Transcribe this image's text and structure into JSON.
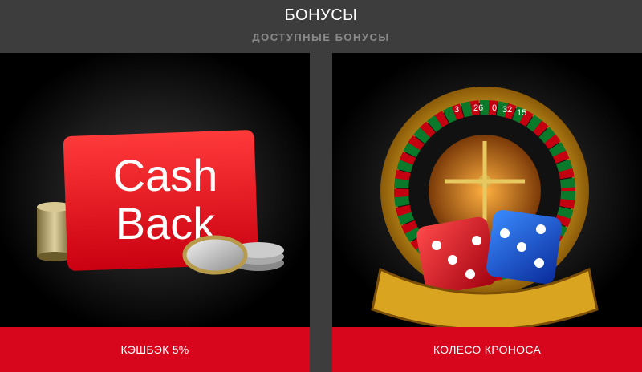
{
  "header": {
    "title": "БОНУСЫ",
    "subtitle": "ДОСТУПНЫЕ БОНУСЫ"
  },
  "cards": [
    {
      "label": "КЭШБЭК 5%",
      "image_text_line1": "Cash",
      "image_text_line2": "Back",
      "image_icon": "cashback-card-coins-image"
    },
    {
      "label": "КОЛЕСО КРОНОСА",
      "image_icon": "roulette-wheel-dice-image",
      "wheel_numbers": [
        "3",
        "26",
        "0",
        "32",
        "15"
      ]
    }
  ],
  "colors": {
    "header_bg": "#3d3d3d",
    "accent_red": "#d8061c",
    "subtitle_gray": "#8a8a8a"
  }
}
